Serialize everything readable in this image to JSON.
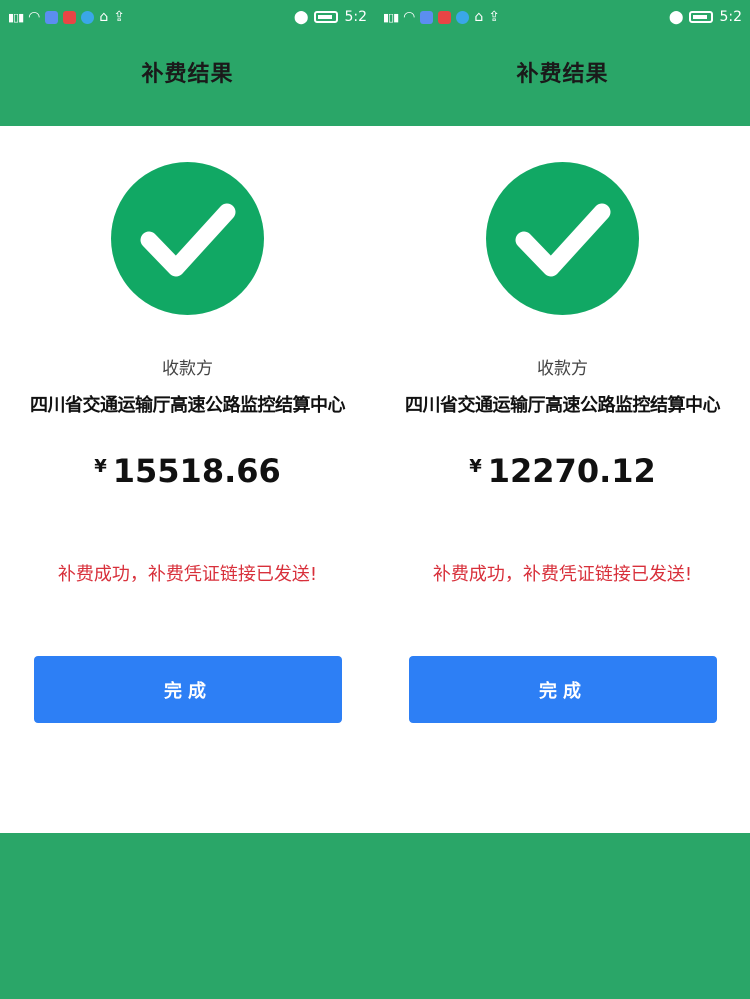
{
  "colors": {
    "header_bg": "#2aa668",
    "check_circle": "#11a864",
    "button_bg": "#2d7ff5",
    "message_text": "#d8303b"
  },
  "screens": [
    {
      "status": {
        "time": "5:2",
        "sig_left": "\"…ıll"
      },
      "header": {
        "title": "补费结果"
      },
      "payee_label": "收款方",
      "payee_name": "四川省交通运输厅高速公路监控结算中心",
      "currency": "¥",
      "amount": "15518.66",
      "message": "补费成功，补费凭证链接已发送!",
      "done_label": "完成"
    },
    {
      "status": {
        "time": "5:2",
        "sig_left": "\"…ıll"
      },
      "header": {
        "title": "补费结果"
      },
      "payee_label": "收款方",
      "payee_name": "四川省交通运输厅高速公路监控结算中心",
      "currency": "¥",
      "amount": "12270.12",
      "message": "补费成功，补费凭证链接已发送!",
      "done_label": "完成"
    }
  ]
}
